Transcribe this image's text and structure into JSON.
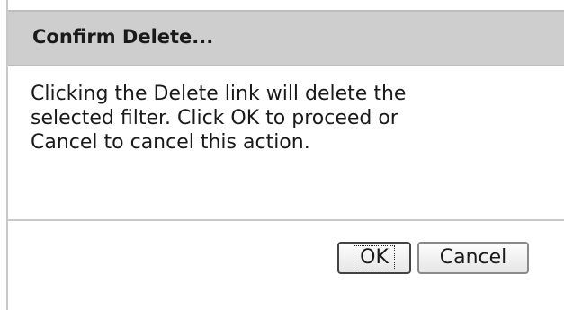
{
  "dialog": {
    "title": "Confirm Delete...",
    "message_lines": [
      "Clicking the Delete link will delete the",
      "selected filter. Click OK to proceed or",
      "Cancel to cancel this action."
    ],
    "buttons": {
      "ok_label": "OK",
      "cancel_label": "Cancel"
    }
  }
}
